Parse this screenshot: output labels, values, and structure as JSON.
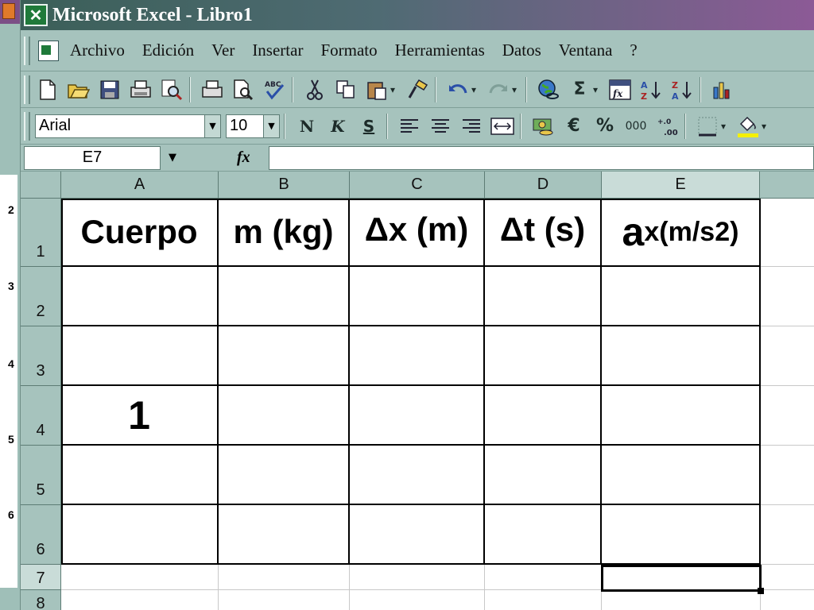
{
  "window": {
    "title": "Microsoft Excel - Libro1"
  },
  "menu": {
    "items": [
      "Archivo",
      "Edición",
      "Ver",
      "Insertar",
      "Formato",
      "Herramientas",
      "Datos",
      "Ventana",
      "?"
    ]
  },
  "standard_toolbar": {
    "icons": [
      "new-icon",
      "open-icon",
      "save-icon",
      "permission-icon",
      "search-icon",
      "print-icon",
      "print-preview-icon",
      "spelling-icon",
      "cut-icon",
      "copy-icon",
      "paste-icon",
      "format-painter-icon",
      "undo-icon",
      "redo-icon",
      "hyperlink-icon",
      "autosum-icon",
      "insert-function-icon",
      "sort-ascending-icon",
      "sort-descending-icon",
      "chart-wizard-icon"
    ],
    "autosum_glyph": "Σ"
  },
  "format_toolbar": {
    "font_name": "Arial",
    "font_size": "10",
    "bold_label": "N",
    "italic_label": "K",
    "underline_label": "S",
    "euro_glyph": "€",
    "percent_glyph": "%",
    "thousands_label": "000",
    "highlight_color": "#f5f000"
  },
  "formula_bar": {
    "name_box": "E7",
    "fx_label": "fx",
    "formula": ""
  },
  "sheet": {
    "columns": [
      "A",
      "B",
      "C",
      "D",
      "E"
    ],
    "rows": [
      "1",
      "2",
      "3",
      "4",
      "5",
      "6",
      "7",
      "8"
    ],
    "selected_cell": "E7",
    "cells": {
      "A1": "Cuerpo",
      "B1": "m (kg)",
      "C1": "Δx (m)",
      "D1": "Δt (s)",
      "E1_main": "a",
      "E1_unit": "x(m/s",
      "E1_exp": "2",
      "E1_close": ")",
      "A4": "1"
    }
  },
  "left_window": {
    "row_numbers": [
      "2",
      "3",
      "4",
      "5",
      "6"
    ]
  },
  "colors": {
    "chrome": "#a6c3bd",
    "title_start": "#3b5f58",
    "title_end": "#8c5a96",
    "excel_green": "#1f7a3a"
  }
}
